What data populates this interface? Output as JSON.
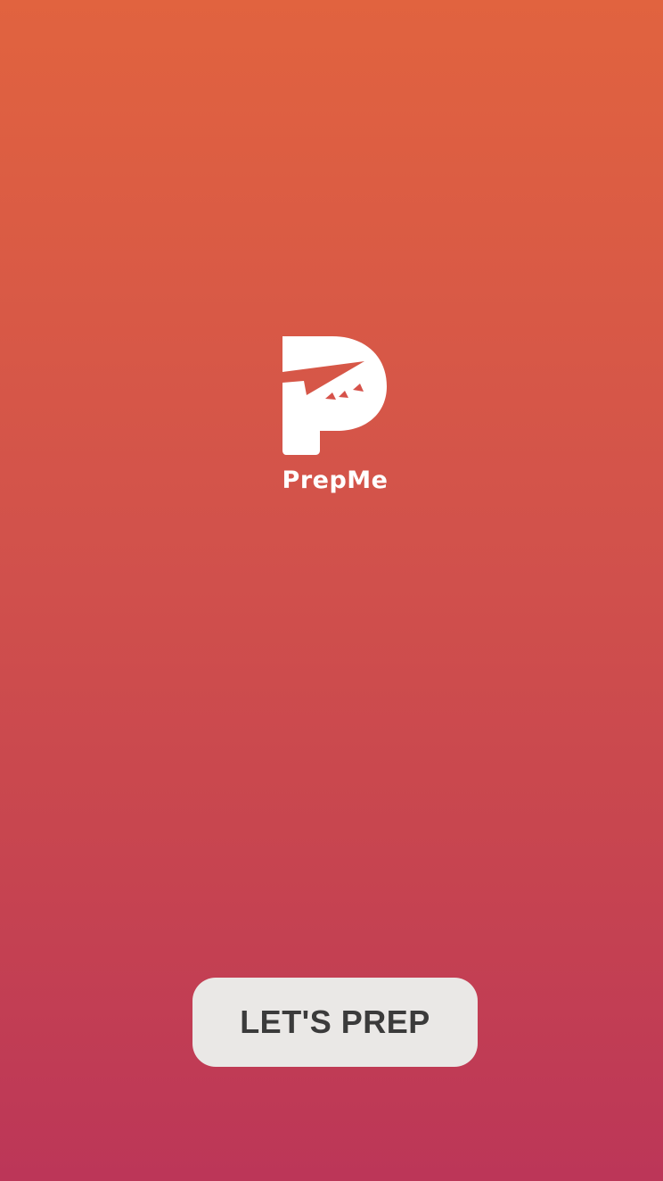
{
  "app": {
    "name": "PrepMe",
    "logo_icon": "prepme-p-logo-icon"
  },
  "actions": {
    "start_label": "LET'S PREP"
  },
  "colors": {
    "gradient_top": "#E1633F",
    "gradient_bottom": "#BC3658",
    "logo": "#FFFFFF",
    "button_bg": "#EAE8E6",
    "button_text": "#3B3B3B"
  }
}
